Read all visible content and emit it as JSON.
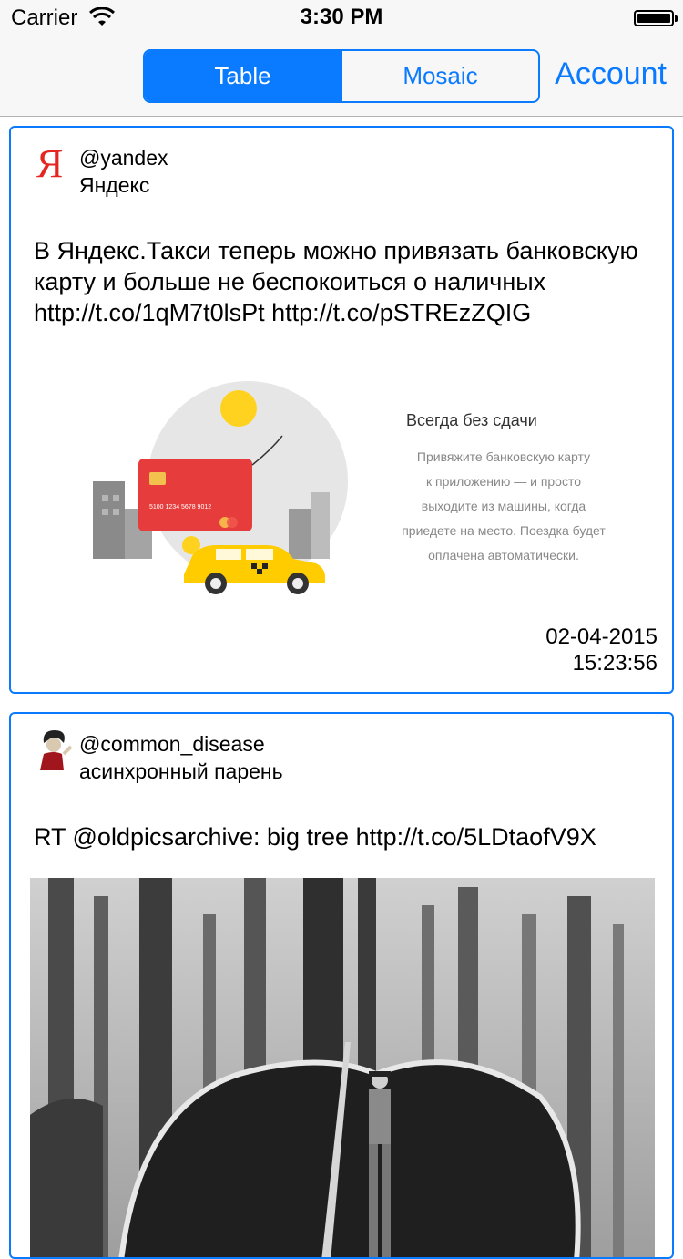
{
  "status_bar": {
    "carrier": "Carrier",
    "time": "3:30 PM"
  },
  "nav": {
    "segments": [
      {
        "label": "Table",
        "selected": true
      },
      {
        "label": "Mosaic",
        "selected": false
      }
    ],
    "account_label": "Account",
    "accent_color": "#0a7aff"
  },
  "feed": [
    {
      "handle": "@yandex",
      "name": "Яндекс",
      "avatar_icon": "yandex-logo-icon",
      "text": "В Яндекс.Такси теперь можно привязать банковскую карту и больше не беспокоиться о наличных http://t.co/1qM7t0lsPt http://t.co/pSTREzZQIG",
      "media": {
        "type": "promo-illustration",
        "title": "Всегда без сдачи",
        "body_lines": [
          "Привяжите банковскую карту",
          "к приложению — и просто",
          "выходите из машины, когда",
          "приедете на место. Поездка будет",
          "оплачена автоматически."
        ],
        "card_number": "5100 1234 5678 9012"
      },
      "date": "02-04-2015",
      "time": "15:23:56"
    },
    {
      "handle": "@common_disease",
      "name": "асинхронный парень",
      "avatar_icon": "cartoon-avatar-icon",
      "text": "RT @oldpicsarchive: big tree http://t.co/5LDtaofV9X",
      "media": {
        "type": "photo",
        "subject": "big-tree-photo"
      }
    }
  ]
}
